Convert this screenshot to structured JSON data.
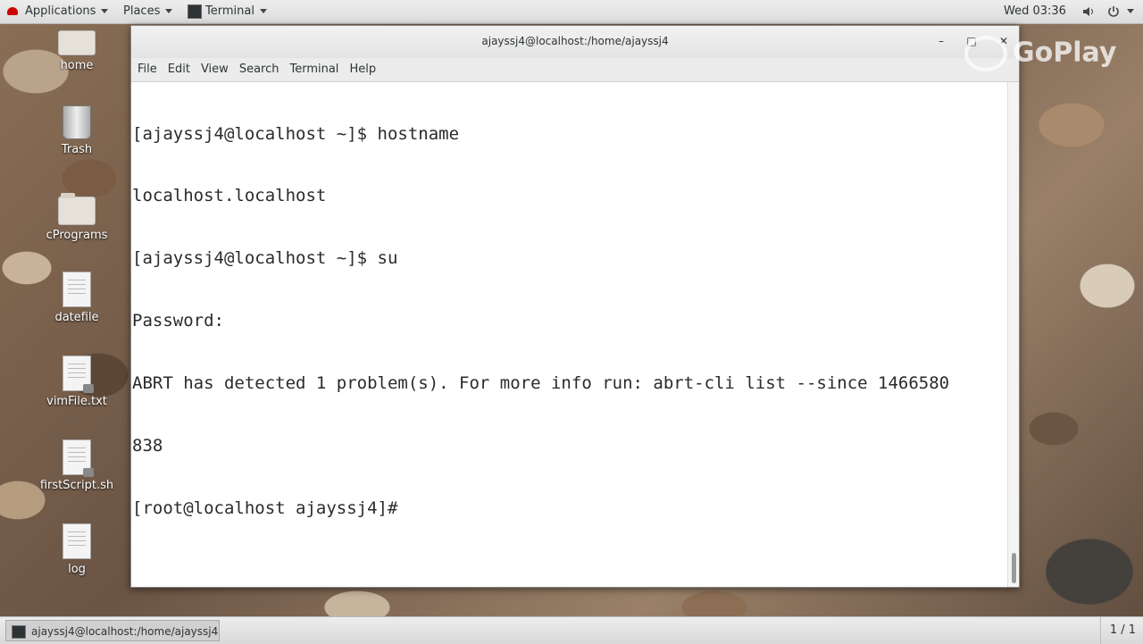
{
  "top_panel": {
    "applications": "Applications",
    "places": "Places",
    "terminal": "Terminal",
    "clock": "Wed 03:36"
  },
  "desktop_icons": [
    {
      "label": "home"
    },
    {
      "label": "Trash"
    },
    {
      "label": "cPrograms"
    },
    {
      "label": "datefile"
    },
    {
      "label": "vimFile.txt"
    },
    {
      "label": "firstScript.sh"
    },
    {
      "label": "log"
    }
  ],
  "window": {
    "title": "ajayssj4@localhost:/home/ajayssj4",
    "menu": [
      "File",
      "Edit",
      "View",
      "Search",
      "Terminal",
      "Help"
    ],
    "lines": [
      "[ajayssj4@localhost ~]$ hostname",
      "localhost.localhost",
      "[ajayssj4@localhost ~]$ su",
      "Password:",
      "ABRT has detected 1 problem(s). For more info run: abrt-cli list --since 1466580",
      "838",
      "[root@localhost ajayssj4]#"
    ]
  },
  "watermark": "GoPlay",
  "bottom_panel": {
    "task": "ajayssj4@localhost:/home/ajayssj4",
    "pager": "1 / 1"
  }
}
